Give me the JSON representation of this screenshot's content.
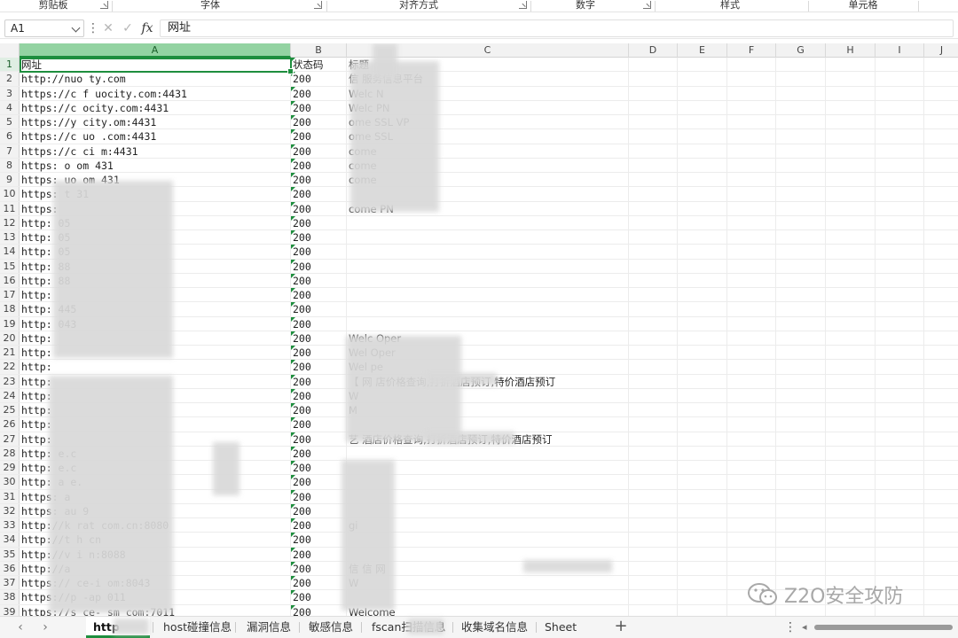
{
  "ribbon": {
    "groups": [
      "剪贴板",
      "字体",
      "对齐方式",
      "数字",
      "样式",
      "单元格"
    ]
  },
  "formula_bar": {
    "name_box": "A1",
    "formula": "网址",
    "fx_label": "fx"
  },
  "columns": [
    "A",
    "B",
    "C",
    "D",
    "E",
    "F",
    "G",
    "H",
    "I",
    "J"
  ],
  "rows": [
    {
      "n": "1",
      "a": "网址",
      "b": "状态码",
      "c": "标题"
    },
    {
      "n": "2",
      "a": "http://nuo  ty.com",
      "b": "200",
      "c": "信                           服务信息平台"
    },
    {
      "n": "3",
      "a": "https://c   f    uocity.com:4431",
      "b": "200",
      "c": "Welc           N"
    },
    {
      "n": "4",
      "a": "https://c       ocity.com:4431",
      "b": "200",
      "c": "Welc        PN"
    },
    {
      "n": "5",
      "a": "https://y    city.om:4431",
      "b": "200",
      "c": "  ome SSL VP"
    },
    {
      "n": "6",
      "a": "https://c     uo   .com:4431",
      "b": "200",
      "c": "  ome SSL"
    },
    {
      "n": "7",
      "a": "https://c     ci    m:4431",
      "b": "200",
      "c": "  come"
    },
    {
      "n": "8",
      "a": "https:       o    om  431",
      "b": "200",
      "c": "  come"
    },
    {
      "n": "9",
      "a": "https:      uo      om  431",
      "b": "200",
      "c": "  come"
    },
    {
      "n": "10",
      "a": "https:         t      31",
      "b": "200",
      "c": ""
    },
    {
      "n": "11",
      "a": "https:",
      "b": "200",
      "c": "  come      PN"
    },
    {
      "n": "12",
      "a": "http:                   05",
      "b": "200",
      "c": ""
    },
    {
      "n": "13",
      "a": "http:                   05",
      "b": "200",
      "c": ""
    },
    {
      "n": "14",
      "a": "http:                   05",
      "b": "200",
      "c": ""
    },
    {
      "n": "15",
      "a": "http:                   88",
      "b": "200",
      "c": ""
    },
    {
      "n": "16",
      "a": "http:                   88",
      "b": "200",
      "c": ""
    },
    {
      "n": "17",
      "a": "http:",
      "b": "200",
      "c": ""
    },
    {
      "n": "18",
      "a": "http:                   445",
      "b": "200",
      "c": ""
    },
    {
      "n": "19",
      "a": "http:                   043",
      "b": "200",
      "c": ""
    },
    {
      "n": "20",
      "a": "http:",
      "b": "200",
      "c": "Welc       Oper"
    },
    {
      "n": "21",
      "a": "http:",
      "b": "200",
      "c": "Wel        Oper"
    },
    {
      "n": "22",
      "a": "http:",
      "b": "200",
      "c": "Wel         pe"
    },
    {
      "n": "23",
      "a": "http:",
      "b": "200",
      "c": "【                网   店价格查询,打折酒店预订,特价酒店预订"
    },
    {
      "n": "24",
      "a": "http:",
      "b": "200",
      "c": "W"
    },
    {
      "n": "25",
      "a": "http:",
      "b": "200",
      "c": "  M"
    },
    {
      "n": "26",
      "a": "http:",
      "b": "200",
      "c": ""
    },
    {
      "n": "27",
      "a": "http:",
      "b": "200",
      "c": " 艺                   酒店价格查询,打折酒店预订,特价酒店预订"
    },
    {
      "n": "28",
      "a": "http:                   e.c",
      "b": "200",
      "c": ""
    },
    {
      "n": "29",
      "a": "http:                   e.c",
      "b": "200",
      "c": ""
    },
    {
      "n": "30",
      "a": "http:              a    e.",
      "b": "200",
      "c": ""
    },
    {
      "n": "31",
      "a": "https:             a",
      "b": "200",
      "c": ""
    },
    {
      "n": "32",
      "a": "https:             au          9",
      "b": "200",
      "c": ""
    },
    {
      "n": "33",
      "a": "http://k     rat                com.cn:8080",
      "b": "200",
      "c": "               gi"
    },
    {
      "n": "34",
      "a": "http://t       h        cn",
      "b": "200",
      "c": ""
    },
    {
      "n": "35",
      "a": "http://v     i              n:8088",
      "b": "200",
      "c": ""
    },
    {
      "n": "36",
      "a": "http://a",
      "b": "200",
      "c": "信                     信          网"
    },
    {
      "n": "37",
      "a": "https://     ce-i           om:8043",
      "b": "200",
      "c": "W"
    },
    {
      "n": "38",
      "a": "https://p   -ap            011",
      "b": "200",
      "c": ""
    },
    {
      "n": "39",
      "a": "https://s     ce-         sm     com:7011",
      "b": "200",
      "c": "Welcome"
    }
  ],
  "tabs": {
    "items": [
      "http",
      "host碰撞信息",
      "漏洞信息",
      "敏感信息",
      "fscan扫描信息",
      "收集域名信息",
      "Sheet"
    ],
    "active_index": 0,
    "add_label": "+"
  },
  "watermark": {
    "text": "Z2O安全攻防"
  },
  "colors": {
    "accent_green": "#1e8e3e",
    "header_selected": "#93d3a2"
  }
}
